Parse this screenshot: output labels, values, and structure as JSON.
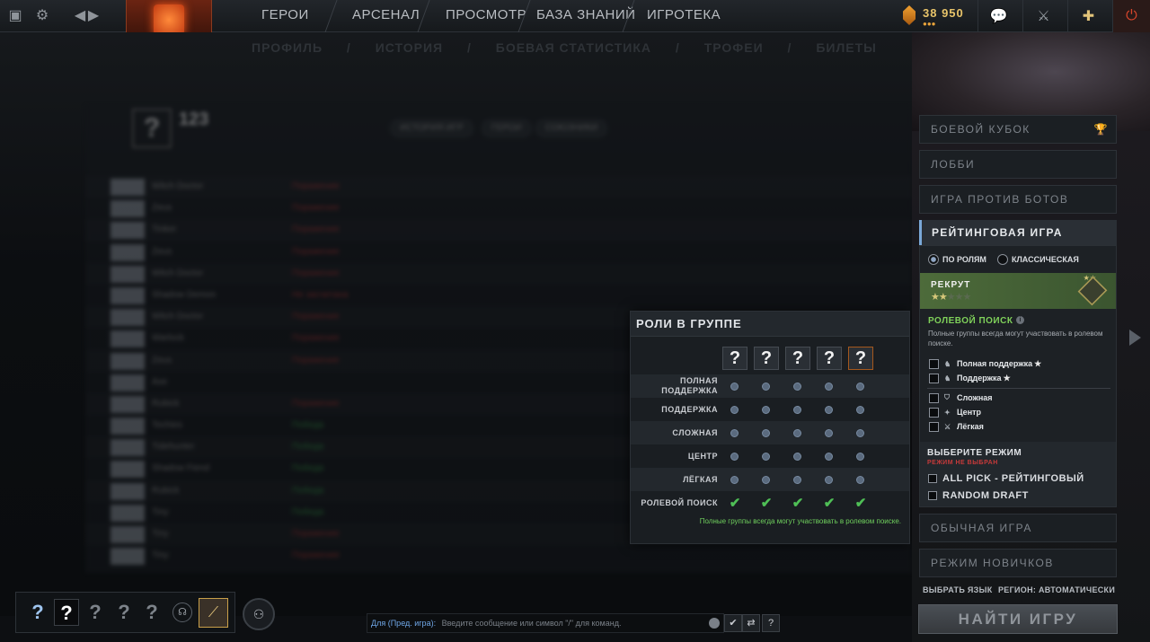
{
  "topbar": {
    "nav": [
      "ГЕРОИ",
      "АРСЕНАЛ",
      "ПРОСМОТР",
      "БАЗА ЗНАНИЙ",
      "ИГРОТЕКА"
    ],
    "currency": "38 950"
  },
  "profile_nav": [
    "ПРОФИЛЬ",
    "/",
    "ИСТОРИЯ",
    "/",
    "БОЕВАЯ СТАТИСТИКА",
    "/",
    "ТРОФЕИ",
    "/",
    "БИЛЕТЫ"
  ],
  "history": {
    "count": "123",
    "tabs": [
      "ИСТОРИЯ ИГР",
      "ГЕРОИ",
      "СОЮЗНИКИ"
    ],
    "rows": [
      {
        "hero": "Witch Doctor",
        "result": "Поражение",
        "win": false
      },
      {
        "hero": "Zeus",
        "result": "Поражение",
        "win": false
      },
      {
        "hero": "Tinker",
        "result": "Поражение",
        "win": false
      },
      {
        "hero": "Zeus",
        "result": "Поражение",
        "win": false
      },
      {
        "hero": "Witch Doctor",
        "result": "Поражение",
        "win": false
      },
      {
        "hero": "Shadow Demon",
        "result": "Не засчитана",
        "win": false
      },
      {
        "hero": "Witch Doctor",
        "result": "Поражение",
        "win": false
      },
      {
        "hero": "Warlock",
        "result": "Поражение",
        "win": false
      },
      {
        "hero": "Zeus",
        "result": "Поражение",
        "win": false
      },
      {
        "hero": "Axe",
        "result": "",
        "win": false
      },
      {
        "hero": "Rubick",
        "result": "Поражение",
        "win": false
      },
      {
        "hero": "Techies",
        "result": "Победа",
        "win": true
      },
      {
        "hero": "Tidehunter",
        "result": "Победа",
        "win": true
      },
      {
        "hero": "Shadow Fiend",
        "result": "Победа",
        "win": true
      },
      {
        "hero": "Rubick",
        "result": "Победа",
        "win": true
      },
      {
        "hero": "Tiny",
        "result": "Победа",
        "win": true
      },
      {
        "hero": "Tiny",
        "result": "Поражение",
        "win": false
      },
      {
        "hero": "Tiny",
        "result": "Поражение",
        "win": false
      }
    ]
  },
  "roles_panel": {
    "title": "РОЛИ В ГРУППЕ",
    "slot": "?",
    "roles": [
      "ПОЛНАЯ ПОДДЕРЖКА",
      "ПОДДЕРЖКА",
      "СЛОЖНАЯ",
      "ЦЕНТР",
      "ЛЁГКАЯ",
      "РОЛЕВОЙ ПОИСК"
    ],
    "check": "✔",
    "note": "Полные группы всегда могут участвовать в ролевом поиске."
  },
  "right_panel": {
    "battle_cup": "БОЕВОЙ КУБОК",
    "lobby": "ЛОББИ",
    "bots": "ИГРА ПРОТИВ БОТОВ",
    "ranked": "РЕЙТИНГОВАЯ ИГРА",
    "radio_roles": "ПО РОЛЯМ",
    "radio_classic": "КЛАССИЧЕСКАЯ",
    "rank_name": "РЕКРУТ",
    "rank_stars_filled": 2,
    "rank_stars_total": 5,
    "role_search_title": "РОЛЕВОЙ ПОИСК",
    "role_search_desc": "Полные группы всегда могут участвовать в ролевом поиске.",
    "role_options": [
      {
        "label": "Полная поддержка",
        "star": true
      },
      {
        "label": "Поддержка",
        "star": true
      },
      {
        "label": "Сложная",
        "star": false
      },
      {
        "label": "Центр",
        "star": false
      },
      {
        "label": "Лёгкая",
        "star": false
      }
    ],
    "mode_title": "ВЫБЕРИТЕ РЕЖИМ",
    "mode_warning": "РЕЖИМ НЕ ВЫБРАН",
    "modes": [
      "ALL PICK - РЕЙТИНГОВЫЙ",
      "RANDOM DRAFT"
    ],
    "normal": "ОБЫЧНАЯ ИГРА",
    "newbie": "РЕЖИМ НОВИЧКОВ",
    "language": "ВЫБРАТЬ ЯЗЫК",
    "region": "РЕГИОН: АВТОМАТИЧЕСКИ",
    "find": "НАЙТИ ИГРУ"
  },
  "chat": {
    "channel": "Для (Пред. игра):",
    "placeholder": "Введите сообщение или символ \"/\" для команд."
  },
  "party": {
    "slot": "?"
  }
}
